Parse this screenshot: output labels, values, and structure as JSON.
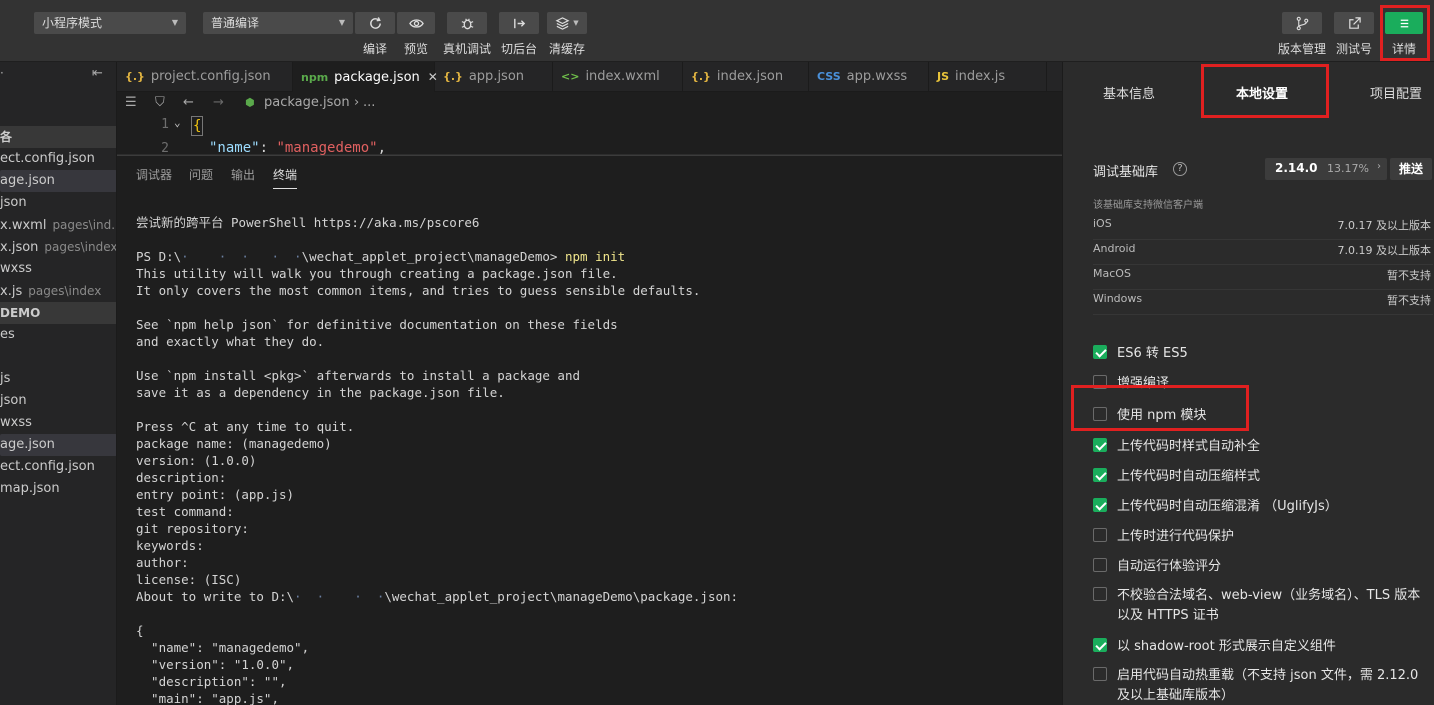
{
  "toolbar": {
    "mode_select": "小程序模式",
    "compile_select": "普通编译",
    "compile_label": "编译",
    "preview_label": "预览",
    "realdebug_label": "真机调试",
    "background_label": "切后台",
    "clearcache_label": "清缓存",
    "version_label": "版本管理",
    "testid_label": "测试号",
    "details_label": "详情"
  },
  "explorer": {
    "rows": [
      {
        "text": "各",
        "type": "hdr"
      },
      {
        "text": "ect.config.json",
        "path": ""
      },
      {
        "text": "age.json",
        "path": "",
        "selected": true
      },
      {
        "text": "json",
        "path": ""
      },
      {
        "text": "x.wxml",
        "path": "pages\\ind..."
      },
      {
        "text": "x.json",
        "path": "pages\\index"
      },
      {
        "text": "wxss",
        "path": ""
      },
      {
        "text": "x.js",
        "path": "pages\\index"
      },
      {
        "text": "DEMO",
        "type": "hdr"
      },
      {
        "text": "es",
        "path": ""
      },
      {
        "text": "",
        "path": ""
      },
      {
        "text": "js",
        "path": ""
      },
      {
        "text": "json",
        "path": ""
      },
      {
        "text": "wxss",
        "path": ""
      },
      {
        "text": "age.json",
        "path": "",
        "selected": true
      },
      {
        "text": "ect.config.json",
        "path": ""
      },
      {
        "text": "map.json",
        "path": ""
      }
    ]
  },
  "tabs": [
    {
      "icon": "{.}",
      "label": "project.config.json",
      "color": "#e0b341"
    },
    {
      "icon": "npm",
      "label": "package.json",
      "color": "#5aa94b",
      "active": true
    },
    {
      "icon": "{.}",
      "label": "app.json",
      "color": "#e0b341"
    },
    {
      "icon": "<>",
      "label": "index.wxml",
      "color": "#6fbf4a"
    },
    {
      "icon": "{.}",
      "label": "index.json",
      "color": "#e0b341"
    },
    {
      "icon": "CSS",
      "label": "app.wxss",
      "color": "#4a90d9"
    },
    {
      "icon": "JS",
      "label": "index.js",
      "color": "#e8c33a"
    }
  ],
  "breadcrumb": {
    "file": "package.json",
    "more": "..."
  },
  "code": {
    "line1": "1",
    "line2": "2",
    "line1_text": "{",
    "line2_key": "\"name\"",
    "line2_colon": ": ",
    "line2_val": "\"managedemo\"",
    "line2_end": ","
  },
  "panel": {
    "tabs": [
      "调试器",
      "问题",
      "输出",
      "终端"
    ],
    "active_tab": "终端"
  },
  "terminal": {
    "line_0": "尝试新的跨平台 PowerShell https://aka.ms/pscore6",
    "line_1": "",
    "prompt_prefix": "PS D:\\",
    "prompt_mask": "·    ·  ·   ·  ·",
    "prompt_path": "\\wechat_applet_project\\manageDemo> ",
    "prompt_cmd": "npm init",
    "line_3": "This utility will walk you through creating a package.json file.",
    "line_4": "It only covers the most common items, and tries to guess sensible defaults.",
    "line_5": "",
    "line_6": "See `npm help json` for definitive documentation on these fields",
    "line_7": "and exactly what they do.",
    "line_8": "",
    "line_9": "Use `npm install <pkg>` afterwards to install a package and",
    "line_10": "save it as a dependency in the package.json file.",
    "line_11": "",
    "line_12": "Press ^C at any time to quit.",
    "line_13": "package name: (managedemo)",
    "line_14": "version: (1.0.0)",
    "line_15": "description:",
    "line_16": "entry point: (app.js)",
    "line_17": "test command:",
    "line_18": "git repository:",
    "line_19": "keywords:",
    "line_20": "author:",
    "line_21": "license: (ISC)",
    "write_prefix": "About to write to D:\\",
    "write_mask": "·  ·    ·  ·",
    "write_path": "\\wechat_applet_project\\manageDemo\\package.json:",
    "line_23": "",
    "line_24": "{",
    "line_25": "  \"name\": \"managedemo\",",
    "line_26": "  \"version\": \"1.0.0\",",
    "line_27": "  \"description\": \"\",",
    "line_28": "  \"main\": \"app.js\","
  },
  "details": {
    "tabs": [
      "基本信息",
      "本地设置",
      "项目配置"
    ],
    "active_tab": "本地设置",
    "lib_label": "调试基础库",
    "help_icon": "?",
    "lib_version": "2.14.0",
    "lib_percent": "13.17%",
    "push_label": "推送",
    "support_note": "该基础库支持微信客户端",
    "platforms": [
      {
        "name": "iOS",
        "value": "7.0.17 及以上版本"
      },
      {
        "name": "Android",
        "value": "7.0.19 及以上版本"
      },
      {
        "name": "MacOS",
        "value": "暂不支持"
      },
      {
        "name": "Windows",
        "value": "暂不支持"
      }
    ],
    "options": [
      {
        "label": "ES6 转 ES5",
        "checked": true
      },
      {
        "label": "增强编译",
        "checked": false
      },
      {
        "label": "使用 npm 模块",
        "checked": false
      },
      {
        "label": "上传代码时样式自动补全",
        "checked": true
      },
      {
        "label": "上传代码时自动压缩样式",
        "checked": true
      },
      {
        "label": "上传代码时自动压缩混淆 （UglifyJs）",
        "checked": true
      },
      {
        "label": "上传时进行代码保护",
        "checked": false
      },
      {
        "label": "自动运行体验评分",
        "checked": false
      },
      {
        "label": "不校验合法域名、web-view（业务域名）、TLS 版本以及 HTTPS 证书",
        "checked": false
      },
      {
        "label": "以 shadow-root 形式展示自定义组件",
        "checked": true
      },
      {
        "label": "启用代码自动热重载（不支持 json 文件，需 2.12.0 及以上基础库版本）",
        "checked": false
      }
    ]
  },
  "colors": {
    "accent_green": "#1aad5c",
    "highlight_red": "#e02020"
  }
}
